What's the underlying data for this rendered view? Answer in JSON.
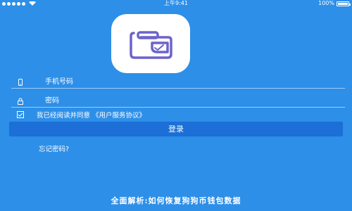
{
  "status_bar": {
    "time": "上午9:41",
    "battery": "100%"
  },
  "form": {
    "phone_placeholder": "手机号码",
    "password_placeholder": "密码",
    "agreement_text": "我已经阅读并同意",
    "agreement_link": "《用户服务协议》",
    "login_label": "登录",
    "forgot_label": "忘记密码?"
  },
  "footer": {
    "title": "全面解析:如何恢复狗狗币钱包数据"
  },
  "colors": {
    "background": "#2d8fe8",
    "button": "#1b6fd6",
    "logo_accent": "#6c63c9"
  },
  "icons": {
    "phone": "phone-icon",
    "lock": "lock-icon",
    "checkbox": "checkbox-icon",
    "app_logo": "wallet-logo-icon"
  }
}
